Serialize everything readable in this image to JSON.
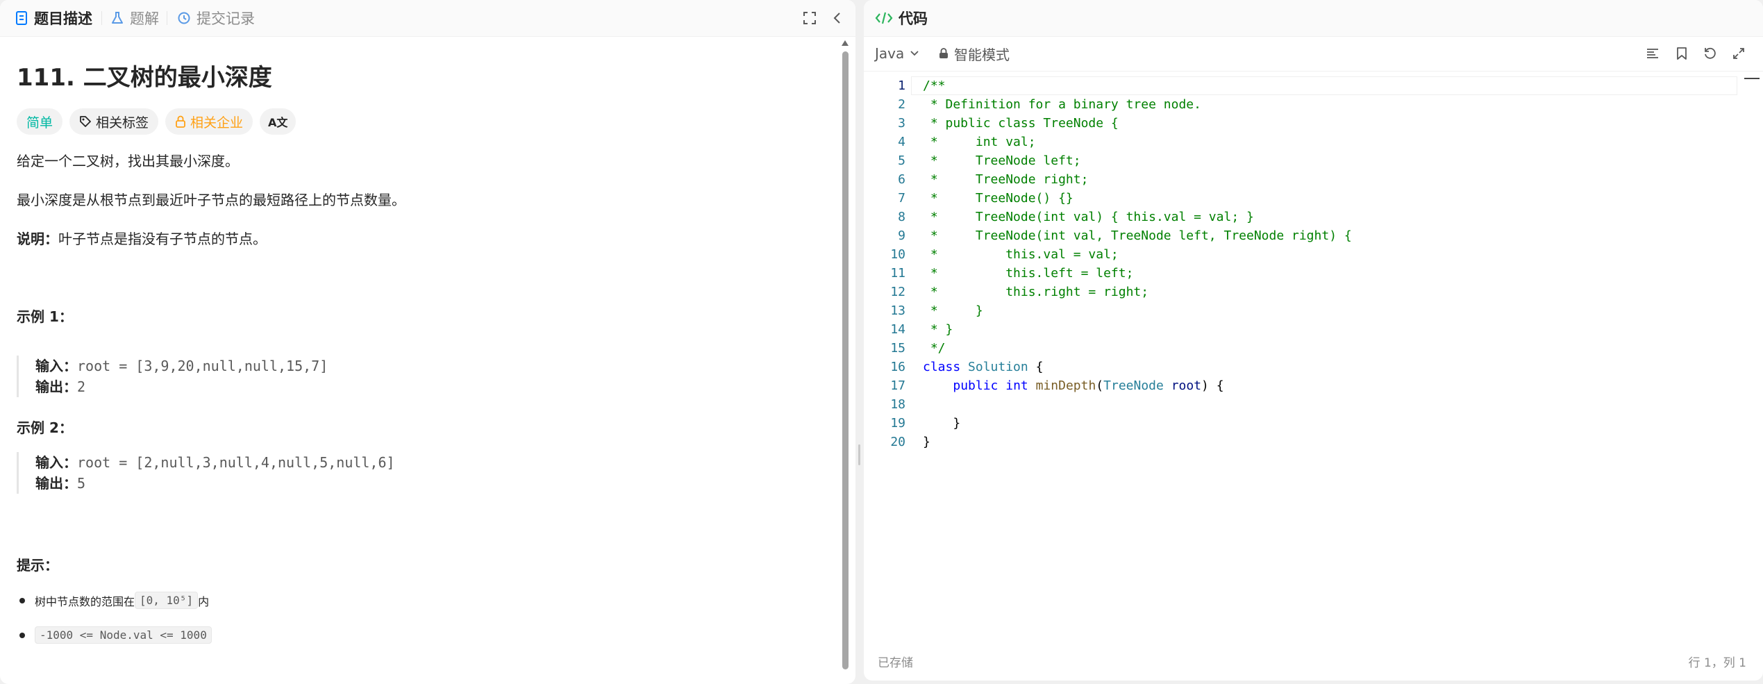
{
  "tabs": [
    {
      "label": "题目描述",
      "icon": "document-icon"
    },
    {
      "label": "题解",
      "icon": "flask-icon"
    },
    {
      "label": "提交记录",
      "icon": "history-icon"
    }
  ],
  "problem": {
    "title": "111. 二叉树的最小深度",
    "chips": {
      "difficulty": "简单",
      "tags": "相关标签",
      "companies": "相关企业",
      "translate": "A文"
    },
    "desc1": "给定一个二叉树，找出其最小深度。",
    "desc2": "最小深度是从根节点到最近叶子节点的最短路径上的节点数量。",
    "note_label": "说明：",
    "note_text": "叶子节点是指没有子节点的节点。",
    "examples": [
      {
        "heading": "示例 1：",
        "input_label": "输入：",
        "input": "root = [3,9,20,null,null,15,7]",
        "output_label": "输出：",
        "output": "2"
      },
      {
        "heading": "示例 2：",
        "input_label": "输入：",
        "input": "root = [2,null,3,null,4,null,5,null,6]",
        "output_label": "输出：",
        "output": "5"
      }
    ],
    "hints_heading": "提示：",
    "hint1_pre": "树中节点数的范围在 ",
    "hint1_code": "[0, 10⁵]",
    "hint1_post": " 内",
    "hint2_code": "-1000 <= Node.val <= 1000"
  },
  "editor": {
    "header_title": "代码",
    "language": "Java",
    "mode": "智能模式",
    "status_saved": "已存储",
    "cursor_pos": "行 1，列 1"
  },
  "code_lines": [
    "/**",
    " * Definition for a binary tree node.",
    " * public class TreeNode {",
    " *     int val;",
    " *     TreeNode left;",
    " *     TreeNode right;",
    " *     TreeNode() {}",
    " *     TreeNode(int val) { this.val = val; }",
    " *     TreeNode(int val, TreeNode left, TreeNode right) {",
    " *         this.val = val;",
    " *         this.left = left;",
    " *         this.right = right;",
    " *     }",
    " * }",
    " */",
    "class Solution {",
    "    public int minDepth(TreeNode root) {",
    "",
    "    }",
    "}"
  ],
  "line_numbers": [
    "1",
    "2",
    "3",
    "4",
    "5",
    "6",
    "7",
    "8",
    "9",
    "10",
    "11",
    "12",
    "13",
    "14",
    "15",
    "16",
    "17",
    "18",
    "19",
    "20"
  ],
  "colors": {
    "accent_green": "#2db55d",
    "easy": "#00b8a3",
    "company": "#ffa116",
    "comment": "#008000",
    "keyword": "#0000ff",
    "type": "#267f99"
  }
}
